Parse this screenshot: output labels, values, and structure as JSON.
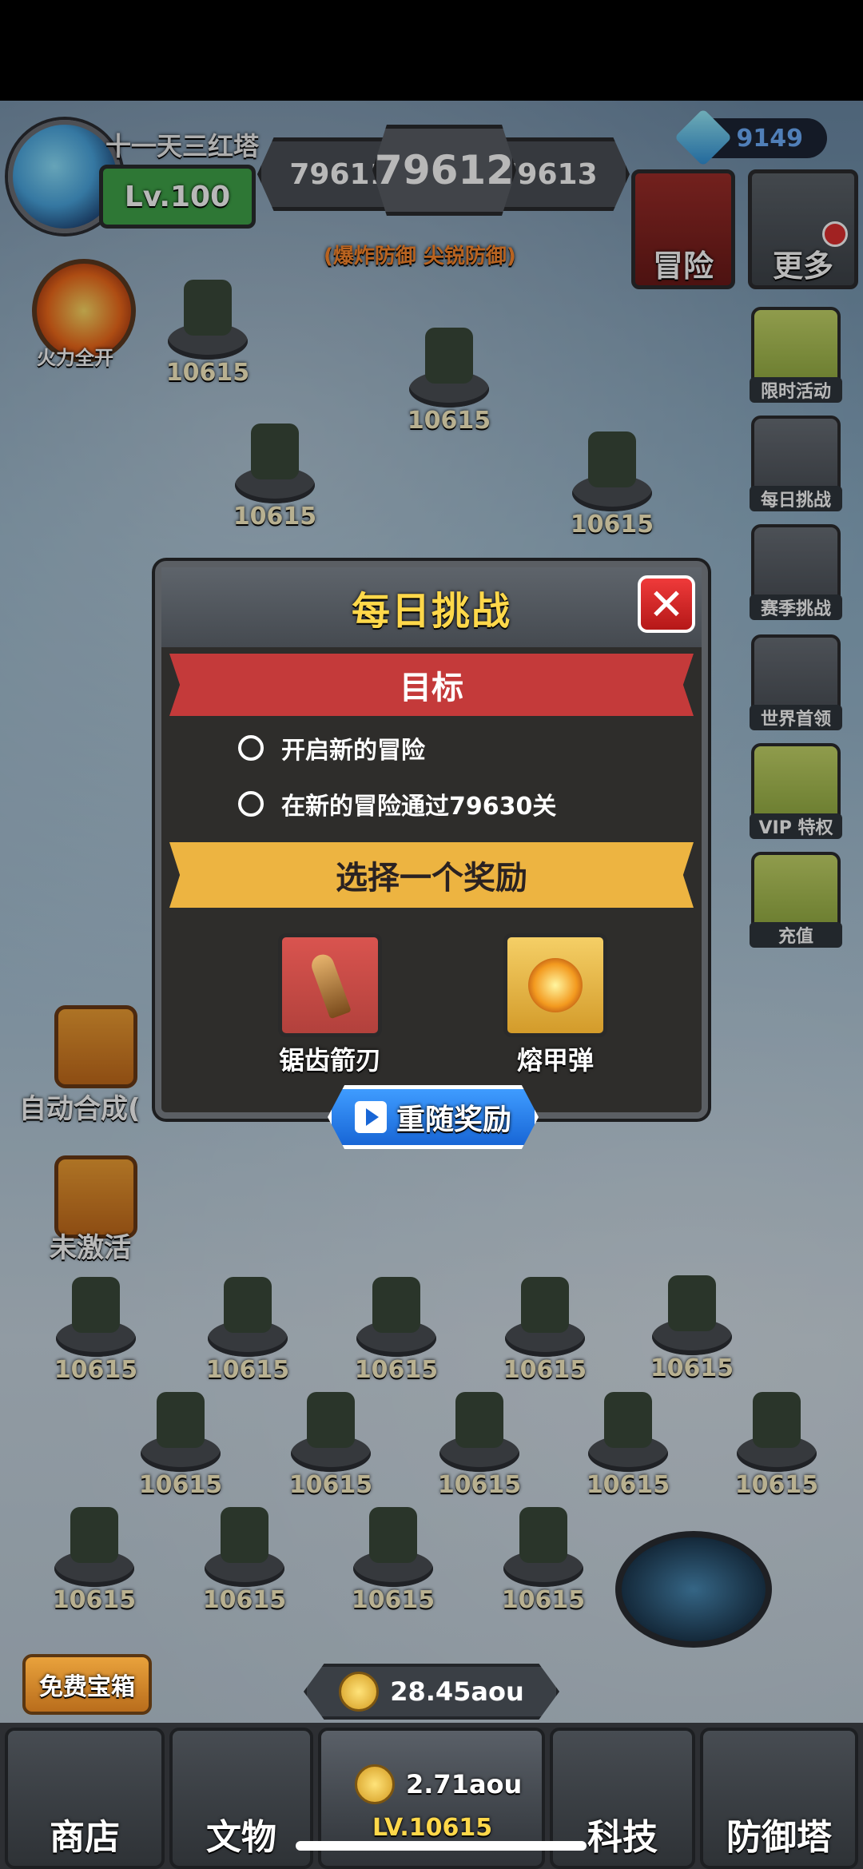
{
  "player": {
    "name": "十一天三红塔",
    "level": "Lv.100"
  },
  "stages": {
    "prev": "79611",
    "current": "79612",
    "next": "79613",
    "defense_note": "(爆炸防御 尖锐防御)"
  },
  "gems": "9149",
  "top_buttons": {
    "adventure": "冒险",
    "more": "更多"
  },
  "left_buttons": {
    "fire": "火力全开",
    "auto_merge": "自动合成(",
    "inactive": "未激活"
  },
  "side_menu": [
    {
      "label": "限时活动",
      "icon": "scroll-icon"
    },
    {
      "label": "每日挑战",
      "icon": "crossed-swords-icon"
    },
    {
      "label": "赛季挑战",
      "icon": "trophy-icon"
    },
    {
      "label": "世界首领",
      "icon": "skull-icon"
    },
    {
      "label": "VIP 特权",
      "icon": "treasure-chest-icon"
    },
    {
      "label": "充值",
      "icon": "gem-cart-icon"
    }
  ],
  "map_tower_values": [
    "10615",
    "10615",
    "10615",
    "10615",
    "10615"
  ],
  "merge_tower_values": [
    "10615",
    "10615",
    "10615",
    "10615",
    "10615",
    "10615",
    "10615",
    "10615",
    "10615",
    "10615",
    "10615",
    "10615",
    "10615",
    "10615"
  ],
  "modal": {
    "title": "每日挑战",
    "goal_header": "目标",
    "objectives": [
      "开启新的冒险",
      "在新的冒险通过79630关"
    ],
    "reward_header": "选择一个奖励",
    "rewards": [
      {
        "label": "锯齿箭刃",
        "icon": "drill-blade-icon"
      },
      {
        "label": "熔甲弹",
        "icon": "explosion-icon"
      }
    ],
    "reroll": "重随奖励"
  },
  "bottom": {
    "free_chest": "免费宝箱",
    "coins": "28.45aou",
    "center_coins": "2.71aou",
    "center_level": "LV.10615",
    "nav": [
      "商店",
      "文物",
      "科技",
      "防御塔"
    ]
  }
}
